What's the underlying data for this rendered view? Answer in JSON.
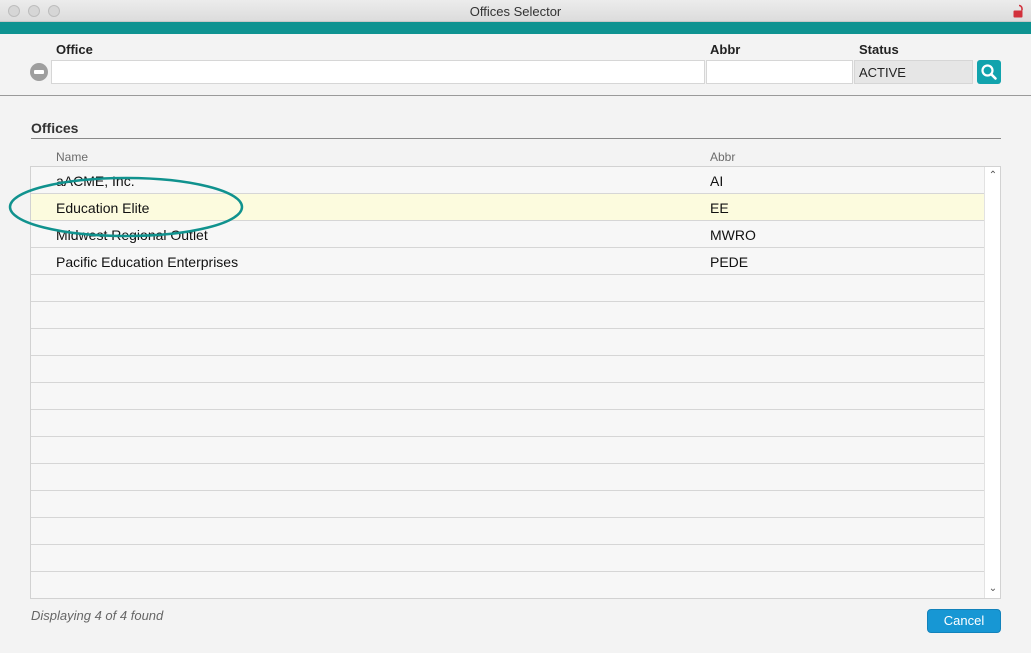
{
  "window": {
    "title": "Offices Selector"
  },
  "filter": {
    "office_label": "Office",
    "office_value": "",
    "abbr_label": "Abbr",
    "abbr_value": "",
    "status_label": "Status",
    "status_value": "ACTIVE"
  },
  "offices": {
    "section_title": "Offices",
    "columns": {
      "name": "Name",
      "abbr": "Abbr"
    },
    "rows": [
      {
        "name": "aACME, Inc.",
        "abbr": "AI"
      },
      {
        "name": "Education Elite",
        "abbr": "EE"
      },
      {
        "name": "Midwest Regional Outlet",
        "abbr": "MWRO"
      },
      {
        "name": "Pacific Education Enterprises",
        "abbr": "PEDE"
      }
    ],
    "selected_index": 1
  },
  "footer": {
    "status_text": "Displaying 4 of 4 found",
    "cancel_label": "Cancel"
  },
  "icons": {
    "clear": "clear-filter-icon",
    "search": "search-icon",
    "lock": "lock-icon",
    "scroll_up": "chevron-up-icon",
    "scroll_down": "chevron-down-icon"
  },
  "colors": {
    "accent_bar": "#0e9391",
    "search_button": "#11a3ad",
    "cancel_button": "#1797d4",
    "selected_row": "#fcfbde",
    "highlight_ellipse": "#10928e",
    "lock_icon": "#d2313c"
  }
}
